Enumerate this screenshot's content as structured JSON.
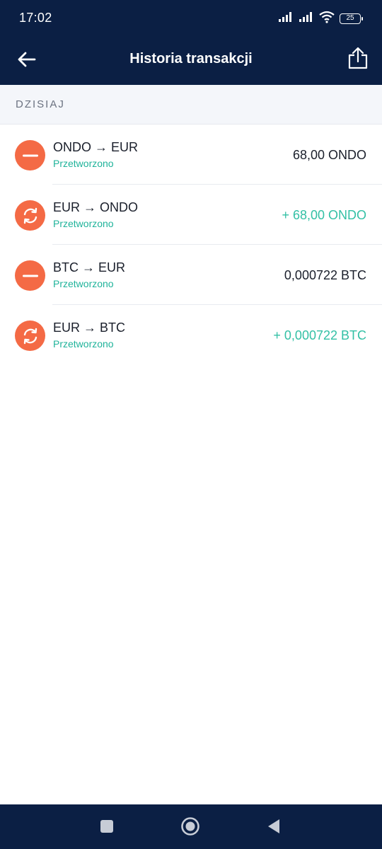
{
  "status_bar": {
    "time": "17:02",
    "battery": "25",
    "icons": [
      "signal-icon",
      "signal-icon",
      "wifi-icon",
      "battery-icon"
    ]
  },
  "app_bar": {
    "title": "Historia transakcji",
    "back_icon": "arrow-left-icon",
    "share_icon": "share-icon"
  },
  "section": {
    "label": "DZISIAJ"
  },
  "transactions": [
    {
      "title": "ONDO → EUR",
      "status": "Przetworzono",
      "amount": "68,00 ONDO",
      "type": "sell",
      "icon": "minus-icon"
    },
    {
      "title": "EUR → ONDO",
      "status": "Przetworzono",
      "amount": "+ 68,00 ONDO",
      "type": "buy",
      "icon": "exchange-icon"
    },
    {
      "title": "BTC → EUR",
      "status": "Przetworzono",
      "amount": "0,000722 BTC",
      "type": "sell",
      "icon": "minus-icon"
    },
    {
      "title": "EUR → BTC",
      "status": "Przetworzono",
      "amount": "+ 0,000722 BTC",
      "type": "buy",
      "icon": "exchange-icon"
    }
  ],
  "colors": {
    "header_bg": "#0b1f44",
    "icon_bg": "#f46a45",
    "status_green": "#1fb39a",
    "positive_amount": "#33c0a5"
  },
  "nav_bar": {
    "icons": [
      "recents-square-icon",
      "home-circle-icon",
      "back-triangle-icon"
    ]
  }
}
